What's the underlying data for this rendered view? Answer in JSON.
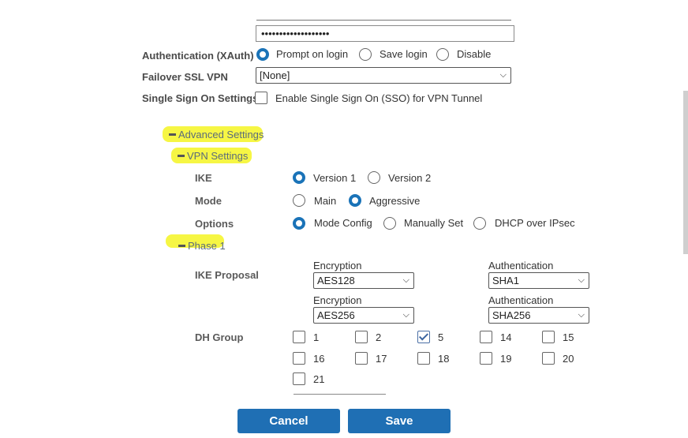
{
  "password_value": "•••••••••••••••••••",
  "auth": {
    "label": "Authentication (XAuth)",
    "options": [
      "Prompt on login",
      "Save login",
      "Disable"
    ],
    "selected": "Prompt on login"
  },
  "failover": {
    "label": "Failover SSL VPN",
    "value": "[None]"
  },
  "sso": {
    "label": "Single Sign On Settings",
    "checkbox_label": "Enable Single Sign On (SSO) for VPN Tunnel",
    "checked": false
  },
  "sections": {
    "advanced": "Advanced Settings",
    "vpn": "VPN Settings",
    "phase1": "Phase 1"
  },
  "ike": {
    "label": "IKE",
    "options": [
      "Version 1",
      "Version 2"
    ],
    "selected": "Version 1"
  },
  "mode": {
    "label": "Mode",
    "options": [
      "Main",
      "Aggressive"
    ],
    "selected": "Aggressive"
  },
  "options": {
    "label": "Options",
    "items": [
      "Mode Config",
      "Manually Set",
      "DHCP over IPsec"
    ],
    "selected": "Mode Config"
  },
  "ike_proposal": {
    "label": "IKE Proposal",
    "rows": [
      {
        "enc_label": "Encryption",
        "enc_value": "AES128",
        "auth_label": "Authentication",
        "auth_value": "SHA1"
      },
      {
        "enc_label": "Encryption",
        "enc_value": "AES256",
        "auth_label": "Authentication",
        "auth_value": "SHA256"
      }
    ]
  },
  "dh_group": {
    "label": "DH Group",
    "groups": [
      "1",
      "2",
      "5",
      "14",
      "15",
      "16",
      "17",
      "18",
      "19",
      "20",
      "21"
    ],
    "checked": [
      "5"
    ]
  },
  "buttons": {
    "cancel": "Cancel",
    "save": "Save"
  },
  "colors": {
    "accent": "#1f6fb4",
    "highlight": "#f5f53a"
  }
}
